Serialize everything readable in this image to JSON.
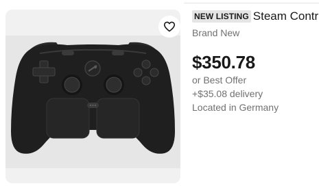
{
  "listing": {
    "badge": "NEW LISTING",
    "title": "Steam Controller",
    "condition": "Brand New",
    "price": "$350.78",
    "offer": "or Best Offer",
    "delivery": "+$35.08 delivery",
    "location": "Located in Germany"
  },
  "image": {
    "subject": "game-controller",
    "watchlist_icon": "heart-icon"
  },
  "colors": {
    "card_bg": "#f1f1f1",
    "photo_bg": "#e6e6e6",
    "controller": "#1f1f1f",
    "text_primary": "#191919",
    "text_secondary": "#707070",
    "badge_bg": "#e5e5e5"
  }
}
